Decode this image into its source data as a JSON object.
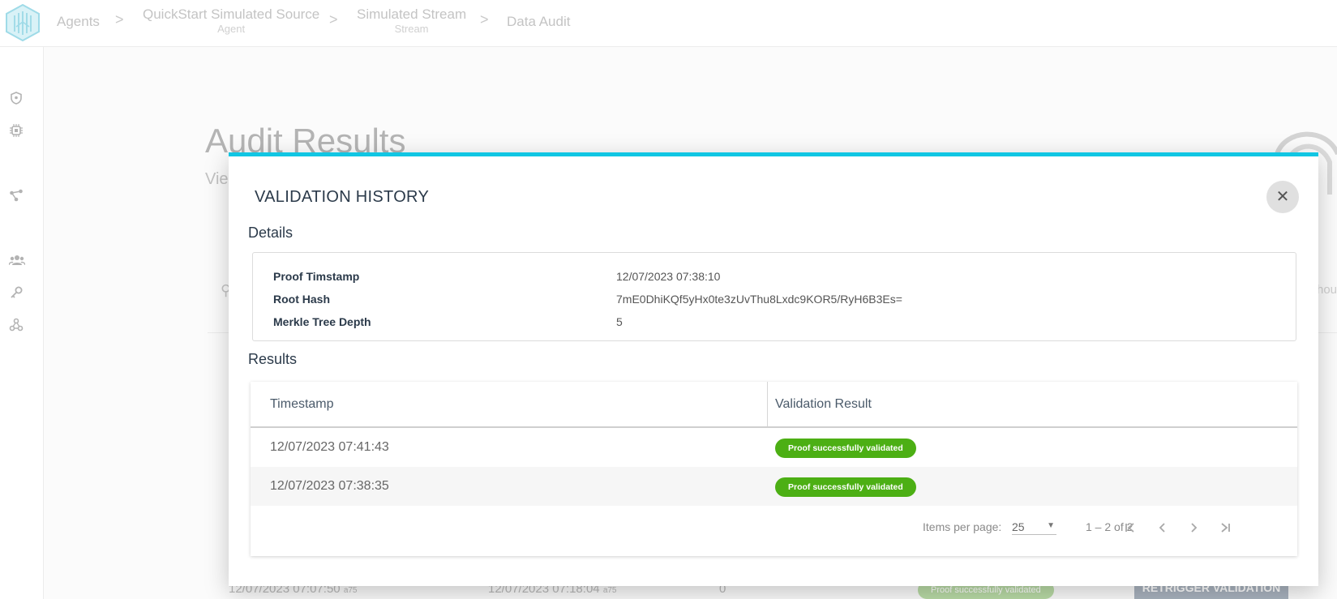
{
  "topbar": {
    "breadcrumbs": [
      {
        "label": "Agents",
        "sub": ""
      },
      {
        "label": "QuickStart Simulated Source",
        "sub": "Agent"
      },
      {
        "label": "Simulated Stream",
        "sub": "Stream"
      },
      {
        "label": "Data Audit",
        "sub": ""
      }
    ],
    "separator": ">"
  },
  "sidebar": {
    "icons": [
      "shield-icon",
      "chip-icon",
      "network-icon",
      "users-icon",
      "key-icon",
      "webhook-icon"
    ]
  },
  "background": {
    "title": "Audit Results",
    "subtitle": "Vie",
    "right_text": "hou",
    "row": {
      "proof_ts": "12/07/2023 07:07:50",
      "proof_ts_suffix": "a75",
      "validated_ts": "12/07/2023 07:18:04",
      "validated_ts_suffix": "a75",
      "count": "0",
      "badge": "Proof successfully validated",
      "retrigger_label": "RETRIGGER VALIDATION"
    }
  },
  "modal": {
    "title": "VALIDATION HISTORY",
    "close_symbol": "✕",
    "details_heading": "Details",
    "details": [
      {
        "label": "Proof Timstamp",
        "value": "12/07/2023 07:38:10"
      },
      {
        "label": "Root Hash",
        "value": "7mE0DhiKQf5yHx0te3zUvThu8Lxdc9KOR5/RyH6B3Es="
      },
      {
        "label": "Merkle Tree Depth",
        "value": "5"
      }
    ],
    "results_heading": "Results",
    "table": {
      "columns": [
        "Timestamp",
        "Validation Result"
      ],
      "rows": [
        {
          "timestamp": "12/07/2023 07:41:43",
          "result": "Proof successfully validated"
        },
        {
          "timestamp": "12/07/2023 07:38:35",
          "result": "Proof successfully validated"
        }
      ]
    },
    "paginator": {
      "items_per_page_label": "Items per page:",
      "items_per_page_value": "25",
      "range_label": "1 – 2 of 2"
    }
  },
  "colors": {
    "accent": "#11c6e3",
    "success": "#4caf14",
    "heading": "#2b3a4a"
  }
}
